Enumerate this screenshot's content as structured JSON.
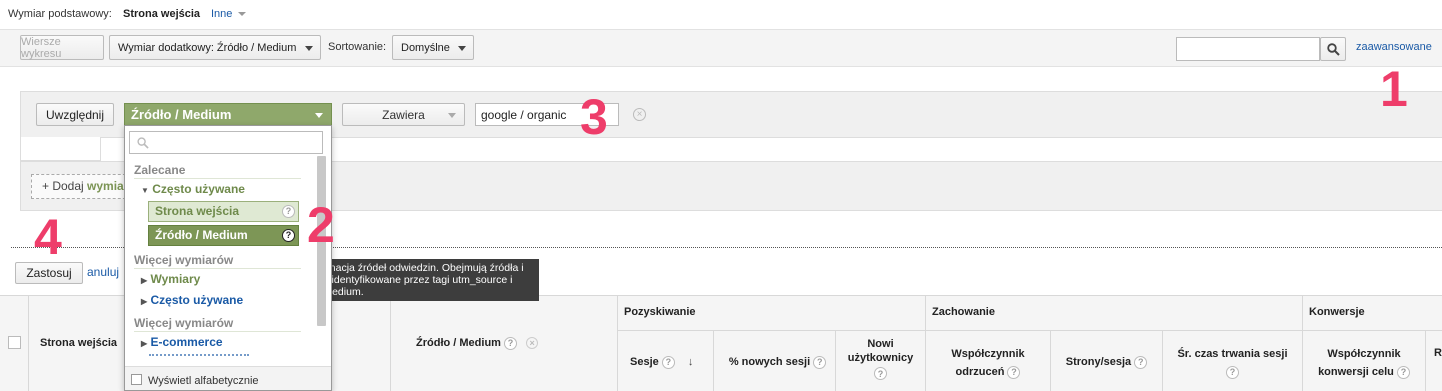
{
  "top": {
    "primary_dim_label": "Wymiar podstawowy:",
    "primary_dim_value": "Strona wejścia",
    "other_label": "Inne"
  },
  "toolbar": {
    "plot_rows": "Wiersze wykresu",
    "secondary_dim": "Wymiar dodatkowy: Źródło / Medium",
    "sort_label": "Sortowanie:",
    "sort_value": "Domyślne",
    "search_placeholder": "",
    "advanced_link": "zaawansowane"
  },
  "filter": {
    "include_button": "Uwzględnij",
    "dimension_select": "Źródło / Medium",
    "match_select": "Zawiera",
    "value_input": "google / organic",
    "add_dimension": "+ Dodaj",
    "add_dimension_bold": "wymia",
    "apply_button": "Zastosuj",
    "cancel_link": "anuluj"
  },
  "dropdown": {
    "search_placeholder": "",
    "group_recommended": "Zalecane",
    "frequent_header": "Często używane",
    "item_landing": "Strona wejścia",
    "item_source_medium": "Źródło / Medium",
    "group_more_1": "Więcej wymiarów",
    "link_dimensions": "Wymiary",
    "link_frequent": "Często używane",
    "group_more_2": "Więcej wymiarów",
    "link_ecommerce": "E-commerce",
    "checkbox_alpha": "Wyświetl alfabetycznie"
  },
  "tooltip": {
    "text": "Kombinacja źródeł odwiedzin. Obejmują źródła i media identyfikowane przez tagi utm_source i utm_medium."
  },
  "table": {
    "col_landing": "Strona wejścia",
    "col_source_medium": "Źródło / Medium",
    "group_acquisition": "Pozyskiwanie",
    "group_behavior": "Zachowanie",
    "group_conversions": "Konwersje",
    "col_sessions": "Sesje",
    "col_new_sessions": "% nowych sesji",
    "col_new_users_1": "Nowi",
    "col_new_users_2": "użytkownicy",
    "col_bounce_1": "Współczynnik",
    "col_bounce_2": "odrzuceń",
    "col_pages": "Strony/sesja",
    "col_duration": "Śr. czas trwania sesji",
    "col_conv_1": "Współczynnik",
    "col_conv_2": "konwersji celu",
    "col_cut": "R"
  },
  "callouts": {
    "one": "1",
    "two": "2",
    "three": "3",
    "four": "4"
  },
  "colors": {
    "accent_green": "#8fa86b",
    "link_blue": "#1a5aa6",
    "callout_pink": "#ee3d6a"
  }
}
